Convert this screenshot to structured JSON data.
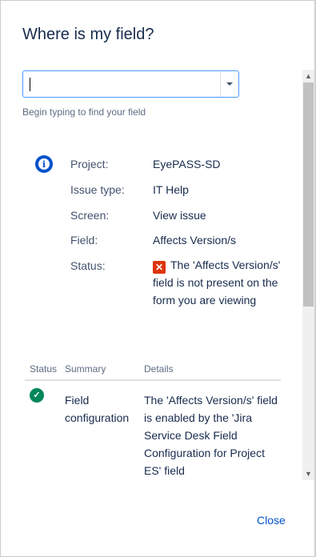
{
  "dialog": {
    "title": "Where is my field?",
    "close_label": "Close"
  },
  "search": {
    "value": "",
    "placeholder": "",
    "hint": "Begin typing to find your field"
  },
  "details": {
    "icon": "info-icon",
    "rows": [
      {
        "label": "Project:",
        "value": "EyePASS-SD"
      },
      {
        "label": "Issue type:",
        "value": "IT Help"
      },
      {
        "label": "Screen:",
        "value": "View issue"
      },
      {
        "label": "Field:",
        "value": "Affects Version/s"
      },
      {
        "label": "Status:",
        "value": "The 'Affects Version/s' field is not present on the form you are viewing",
        "icon": "error-icon"
      }
    ]
  },
  "table": {
    "headers": [
      "Status",
      "Summary",
      "Details"
    ],
    "rows": [
      {
        "status_icon": "check-icon",
        "summary": "Field configuration",
        "details": "The 'Affects Version/s' field is enabled by the 'Jira Service Desk Field Configuration for Project ES' field"
      }
    ]
  },
  "colors": {
    "accent": "#0052cc",
    "error": "#de350b",
    "success": "#00875a"
  }
}
